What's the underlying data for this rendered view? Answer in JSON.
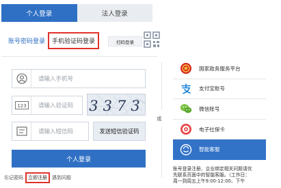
{
  "tabs": [
    {
      "label": "个人登录",
      "active": true
    },
    {
      "label": "法人登录",
      "active": false
    }
  ],
  "login_modes": {
    "password": "账号密码登录",
    "sms": "手机验证码登录",
    "scan": "扫码登录"
  },
  "fields": {
    "phone_placeholder": "请输入手机号",
    "captcha_placeholder": "请输入验证码",
    "sms_code_placeholder": "请输入短信码"
  },
  "captcha_text": "3373",
  "send_sms_button": "发送短信验证码",
  "login_button": "个人登录",
  "links": {
    "forgot": "忘记密码",
    "register": "立即注册",
    "issue": "遇到问题"
  },
  "or_text": "或",
  "providers": [
    {
      "label": "国家政务服务平台",
      "icon": "national-emblem-icon",
      "active": false
    },
    {
      "label": "支付宝账号",
      "icon": "alipay-icon",
      "active": false
    },
    {
      "label": "微信账号",
      "icon": "wechat-icon",
      "active": false
    },
    {
      "label": "电子社保卡",
      "icon": "social-security-card-icon",
      "active": false
    },
    {
      "label": "智能客服",
      "icon": "smart-service-icon",
      "active": true
    }
  ],
  "notice": {
    "line1": "账号登录注册、企业绑定相关问题请优",
    "line2": "先联系页面中的智能客服。（工作日：",
    "line3": "周一到周五上午9:00-12:00、下午"
  },
  "colors": {
    "primary": "#2f70c4",
    "highlight_red": "#e0322b"
  }
}
